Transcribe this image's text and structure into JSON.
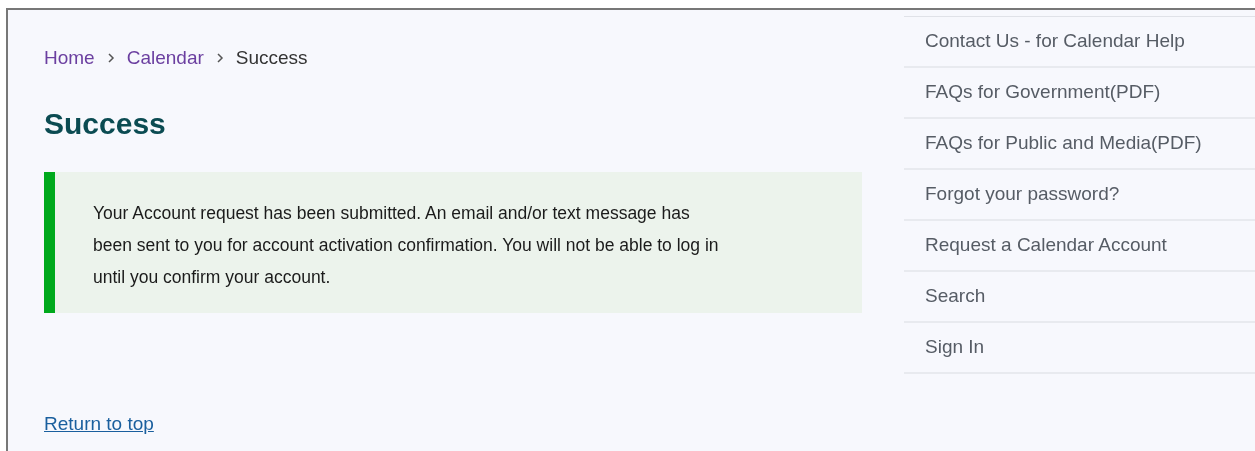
{
  "breadcrumb": [
    {
      "label": "Home",
      "link": true
    },
    {
      "label": "Calendar",
      "link": true
    },
    {
      "label": "Success",
      "link": false
    }
  ],
  "heading": "Success",
  "alert": {
    "kind": "success",
    "message": "Your Account request has been submitted. An email and/or text message has been sent to you for account activation confirmation. You will not be able to log in until you confirm your account."
  },
  "return_link": "Return to top",
  "sidebar": {
    "items": [
      "Contact Us - for Calendar Help",
      "FAQs for Government(PDF)",
      "FAQs for Public and Media(PDF)",
      "Forgot your password?",
      "Request a Calendar Account",
      "Search",
      "Sign In"
    ]
  }
}
